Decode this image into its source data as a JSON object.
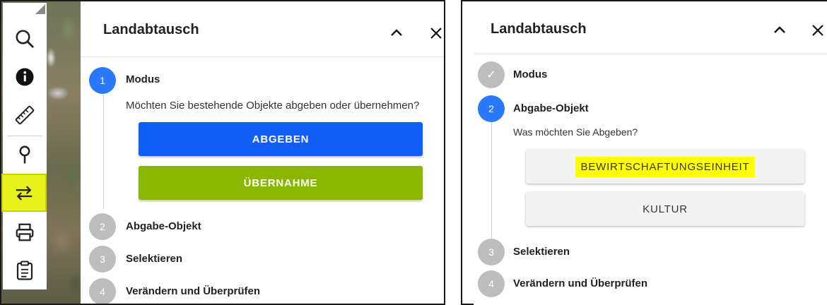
{
  "left_panel": {
    "title": "Landabtausch",
    "steps": [
      {
        "number": "1",
        "label": "Modus",
        "state": "active"
      },
      {
        "number": "2",
        "label": "Abgabe-Objekt",
        "state": "inactive"
      },
      {
        "number": "3",
        "label": "Selektieren",
        "state": "inactive"
      },
      {
        "number": "4",
        "label": "Verändern und Überprüfen",
        "state": "inactive"
      }
    ],
    "question": "Möchten Sie bestehende Objekte abgeben oder übernehmen?",
    "buttons": {
      "abgeben": "ABGEBEN",
      "uebernahme": "ÜBERNAHME"
    }
  },
  "right_panel": {
    "title": "Landabtausch",
    "steps": [
      {
        "number": "✓",
        "label": "Modus",
        "state": "done"
      },
      {
        "number": "2",
        "label": "Abgabe-Objekt",
        "state": "active"
      },
      {
        "number": "3",
        "label": "Selektieren",
        "state": "inactive"
      },
      {
        "number": "4",
        "label": "Verändern und Überprüfen",
        "state": "inactive"
      }
    ],
    "question": "Was möchten Sie Abgeben?",
    "buttons": {
      "bewirtschaftungseinheit": "BEWIRTSCHAFTUNGSEINHEIT",
      "kultur": "KULTUR"
    }
  },
  "toolbar": {
    "icons": [
      "search-icon",
      "info-icon",
      "ruler-icon",
      "location-pin-icon",
      "swap-arrows-icon",
      "print-icon",
      "clipboard-icon"
    ]
  },
  "colors": {
    "active_step": "#2979ff",
    "inactive_step": "#bdbdbd",
    "abgeben_button": "#0f5ef7",
    "uebernahme_button": "#8ab600",
    "highlight": "#ffff00"
  }
}
